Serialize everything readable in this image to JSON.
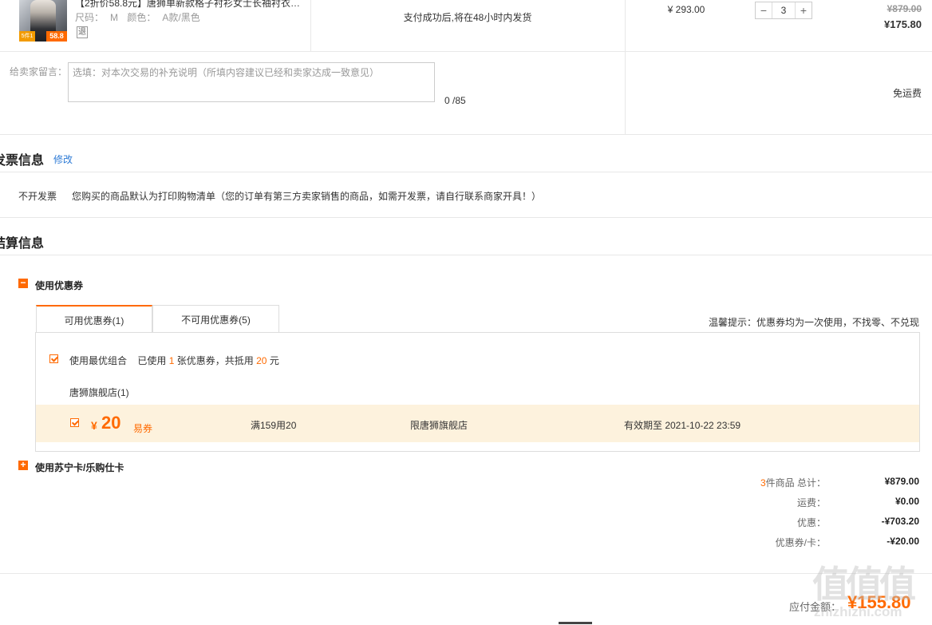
{
  "product": {
    "thumb_badge": "58.8",
    "thumb_badge_small": "5件1折",
    "title": "【2折价58.8元】唐狮单新款格子衬衫女士长袖衬衣…",
    "size_label": "尺码：",
    "size": "M",
    "color_label": "颜色：",
    "color": "A款/黑色",
    "return_badge": "退",
    "shipping_note": "支付成功后,将在48小时内发货",
    "unit_price": "¥ 293.00",
    "quantity": "3",
    "qty_minus": "−",
    "qty_plus": "+",
    "original_total": "¥879.00",
    "total": "¥175.80"
  },
  "message": {
    "label": "给卖家留言：",
    "placeholder": "选填：对本次交易的补充说明（所填内容建议已经和卖家达成一致意见）",
    "count": "0 /85",
    "shipping_fee": "免运费"
  },
  "invoice": {
    "title": "发票信息",
    "modify": "修改",
    "type": "不开发票",
    "note": "您购买的商品默认为打印购物清单（您的订单有第三方卖家销售的商品，如需开发票，请自行联系商家开具！）"
  },
  "settlement": {
    "title": "结算信息",
    "coupon_section": {
      "toggle": "−",
      "label": "使用优惠券",
      "tabs": [
        {
          "label": "可用优惠券(1)",
          "active": true
        },
        {
          "label": "不可用优惠券(5)",
          "active": false
        }
      ],
      "tip": "温馨提示：优惠券均为一次使用，不找零、不兑现",
      "best_combo_label": "使用最优组合",
      "used_prefix": "已使用",
      "used_count": "1",
      "used_mid": "张优惠券，共抵用",
      "used_amount": "20",
      "used_suffix": "元",
      "store": "唐狮旗舰店(1)",
      "coupon": {
        "currency": "¥",
        "amount": "20",
        "kind": "易券",
        "rule": "满159用20",
        "scope": "限唐狮旗舰店",
        "validity": "有效期至 2021-10-22 23:59"
      }
    },
    "card_section": {
      "toggle": "+",
      "label": "使用苏宁卡/乐购仕卡"
    },
    "summary": {
      "items_count": "3",
      "items_label": "件商品 总计：",
      "items_total": "¥879.00",
      "shipping_label": "运费：",
      "shipping": "¥0.00",
      "discount_label": "优惠：",
      "discount": "-¥703.20",
      "coupon_label": "优惠券/卡：",
      "coupon": "-¥20.00"
    },
    "payable_label": "应付金额：",
    "payable": "¥155.80"
  },
  "watermark": {
    "chars": "值值值",
    "domain": "zhizhizhi.com"
  },
  "colors": {
    "accent": "#ff6a00",
    "coupon_bg": "#fdf2dd",
    "link": "#2e7bd6"
  }
}
